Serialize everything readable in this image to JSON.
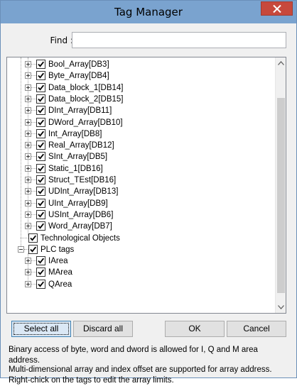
{
  "window": {
    "title": "Tag Manager",
    "close_icon": "close-icon"
  },
  "find": {
    "label": "Find :",
    "value": "",
    "placeholder": ""
  },
  "tree": {
    "items": [
      {
        "label": "Bool_Array[DB3]",
        "checked": true,
        "expandable": true
      },
      {
        "label": "Byte_Array[DB4]",
        "checked": true,
        "expandable": true
      },
      {
        "label": "Data_block_1[DB14]",
        "checked": true,
        "expandable": true
      },
      {
        "label": "Data_block_2[DB15]",
        "checked": true,
        "expandable": true
      },
      {
        "label": "DInt_Array[DB11]",
        "checked": true,
        "expandable": true
      },
      {
        "label": "DWord_Array[DB10]",
        "checked": true,
        "expandable": true
      },
      {
        "label": "Int_Array[DB8]",
        "checked": true,
        "expandable": true
      },
      {
        "label": "Real_Array[DB12]",
        "checked": true,
        "expandable": true
      },
      {
        "label": "SInt_Array[DB5]",
        "checked": true,
        "expandable": true
      },
      {
        "label": "Static_1[DB16]",
        "checked": true,
        "expandable": true
      },
      {
        "label": "Struct_TEst[DB16]",
        "checked": true,
        "expandable": true
      },
      {
        "label": "UDInt_Array[DB13]",
        "checked": true,
        "expandable": true
      },
      {
        "label": "UInt_Array[DB9]",
        "checked": true,
        "expandable": true
      },
      {
        "label": "USInt_Array[DB6]",
        "checked": true,
        "expandable": true
      },
      {
        "label": "Word_Array[DB7]",
        "checked": true,
        "expandable": true
      },
      {
        "label": "Technological Objects",
        "checked": true,
        "expandable": false
      },
      {
        "label": "PLC tags",
        "checked": true,
        "expandable": true,
        "expanded": true
      },
      {
        "label": "IArea",
        "checked": true,
        "expandable": true
      },
      {
        "label": "MArea",
        "checked": true,
        "expandable": true
      },
      {
        "label": "QArea",
        "checked": true,
        "expandable": true
      }
    ]
  },
  "buttons": {
    "select_all": "Select all",
    "discard_all": "Discard all",
    "ok": "OK",
    "cancel": "Cancel"
  },
  "notes": {
    "line1": "Binary access of byte, word and dword is allowed for I, Q and M area address.",
    "line2": "Multi-dimensional array and index offset are supported for array address.",
    "line3": "Right-chick on the tags to edit the array limits."
  },
  "colors": {
    "titlebar": "#7aa3cf",
    "close_button": "#c7493c",
    "window_bg": "#f0f0f0",
    "accent_focus": "#3c7fb1"
  }
}
